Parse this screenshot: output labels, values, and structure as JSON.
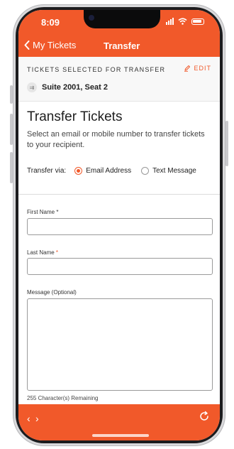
{
  "status": {
    "time": "8:09"
  },
  "nav": {
    "back_label": "My Tickets",
    "title": "Transfer"
  },
  "selected": {
    "label": "TICKETS SELECTED FOR TRANSFER",
    "edit_label": "EDIT",
    "seat": "Suite 2001, Seat 2"
  },
  "transfer": {
    "heading": "Transfer Tickets",
    "description": "Select an email or mobile number to transfer tickets to your recipient.",
    "via_label": "Transfer via:",
    "options": [
      {
        "label": "Email Address",
        "selected": true
      },
      {
        "label": "Text Message",
        "selected": false
      }
    ]
  },
  "form": {
    "first_name_label": "First Name",
    "last_name_label": "Last Name",
    "required_mark": "*",
    "first_name_value": "",
    "last_name_value": "",
    "message_label": "Message (Optional)",
    "message_value": "",
    "remaining": "255 Character(s) Remaining"
  },
  "icons": {
    "back": "chevron-left-icon",
    "edit": "pencil-icon",
    "seat": "ticket-icon",
    "prev": "chevron-left-icon",
    "next": "chevron-right-icon",
    "refresh": "refresh-icon"
  },
  "colors": {
    "accent": "#f1592a"
  }
}
